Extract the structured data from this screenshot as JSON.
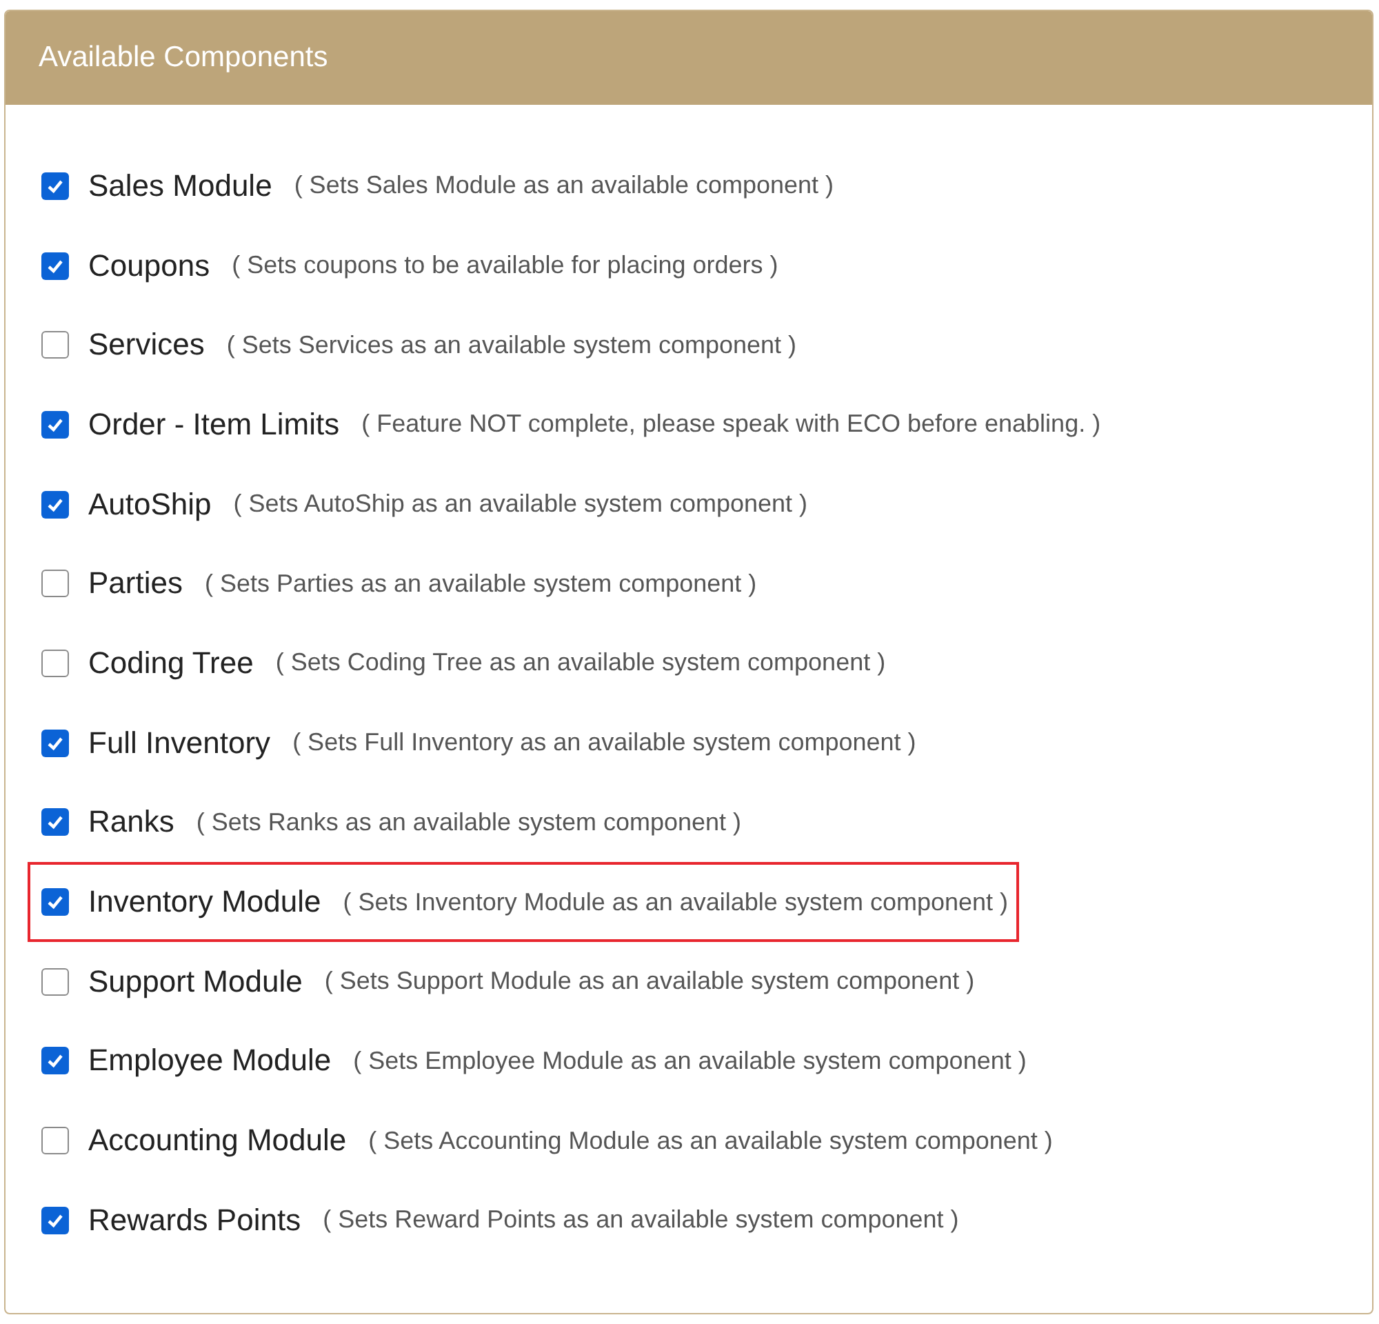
{
  "panel": {
    "title": "Available Components"
  },
  "components": [
    {
      "label": "Sales Module",
      "description": "( Sets Sales Module as an available component )",
      "checked": true,
      "highlighted": false
    },
    {
      "label": "Coupons",
      "description": "( Sets coupons to be available for placing orders )",
      "checked": true,
      "highlighted": false
    },
    {
      "label": "Services",
      "description": "( Sets Services as an available system component )",
      "checked": false,
      "highlighted": false
    },
    {
      "label": "Order - Item Limits",
      "description": "( Feature NOT complete, please speak with ECO before enabling. )",
      "checked": true,
      "highlighted": false
    },
    {
      "label": "AutoShip",
      "description": "( Sets AutoShip as an available system component )",
      "checked": true,
      "highlighted": false
    },
    {
      "label": "Parties",
      "description": "( Sets Parties as an available system component )",
      "checked": false,
      "highlighted": false
    },
    {
      "label": "Coding Tree",
      "description": "( Sets Coding Tree as an available system component )",
      "checked": false,
      "highlighted": false
    },
    {
      "label": "Full Inventory",
      "description": "( Sets Full Inventory as an available system component )",
      "checked": true,
      "highlighted": false
    },
    {
      "label": "Ranks",
      "description": "( Sets Ranks as an available system component )",
      "checked": true,
      "highlighted": false
    },
    {
      "label": "Inventory Module",
      "description": "( Sets Inventory Module as an available system component )",
      "checked": true,
      "highlighted": true
    },
    {
      "label": "Support Module",
      "description": "( Sets Support Module as an available system component )",
      "checked": false,
      "highlighted": false
    },
    {
      "label": "Employee Module",
      "description": "( Sets Employee Module as an available system component )",
      "checked": true,
      "highlighted": false
    },
    {
      "label": "Accounting Module",
      "description": "( Sets Accounting Module as an available system component )",
      "checked": false,
      "highlighted": false
    },
    {
      "label": "Rewards Points",
      "description": "( Sets Reward Points as an available system component )",
      "checked": true,
      "highlighted": false
    }
  ]
}
